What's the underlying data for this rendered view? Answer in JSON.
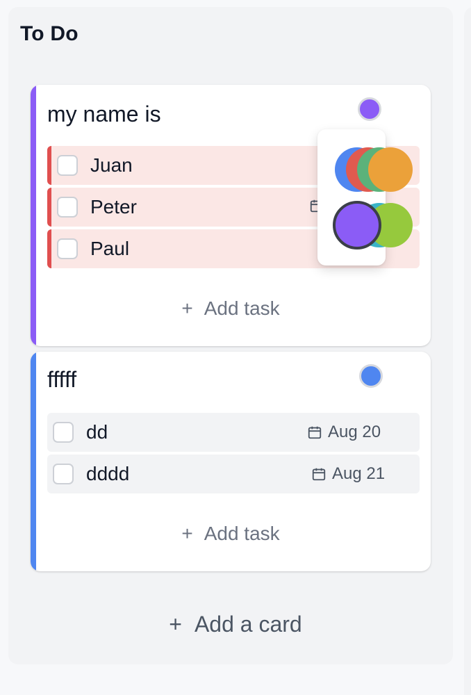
{
  "column": {
    "title": "To Do"
  },
  "cards": [
    {
      "title": "my name is",
      "accent_color": "#8b5cf6",
      "dot_color": "#8b5cf6",
      "tasks": [
        {
          "label": "Juan"
        },
        {
          "label": "Peter"
        },
        {
          "label": "Paul"
        }
      ],
      "add_task_label": "Add task",
      "add_task_icon": "plus-icon"
    },
    {
      "title": "fffff",
      "accent_color": "#4f86f0",
      "dot_color": "#4f86f0",
      "tasks": [
        {
          "label": "dd",
          "due": "Aug 20",
          "due_icon": "calendar-icon"
        },
        {
          "label": "dddd",
          "due": "Aug 21",
          "due_icon": "calendar-icon"
        }
      ],
      "add_task_label": "Add task",
      "add_task_icon": "plus-icon"
    }
  ],
  "add_card": {
    "label": "Add a card",
    "icon": "plus-icon"
  },
  "color_picker": {
    "colors": [
      "#4f86f0",
      "#e05a4f",
      "#5bb27a",
      "#eba13a",
      "#8b5cf6",
      "#3bb4c8",
      "#96c93d"
    ],
    "selected": "#8b5cf6"
  }
}
